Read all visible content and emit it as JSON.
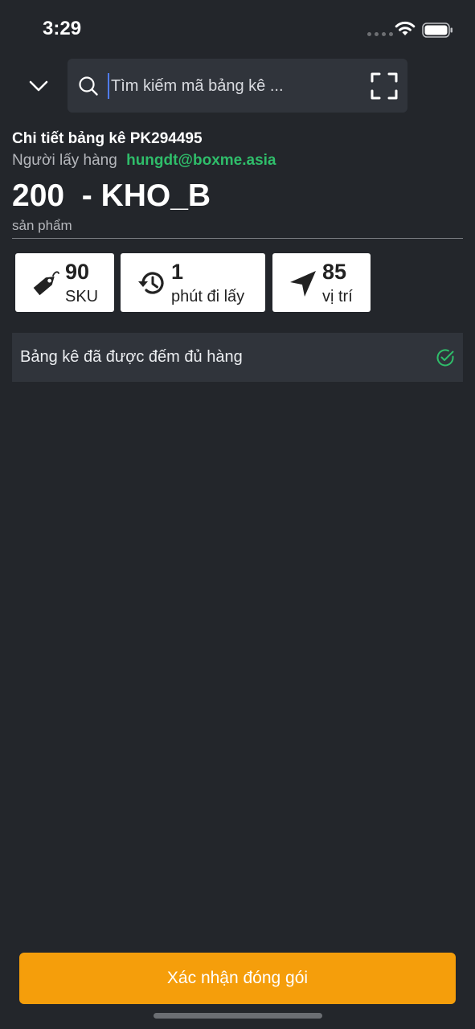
{
  "status_bar": {
    "time": "3:29"
  },
  "search": {
    "placeholder": "Tìm kiếm mã bảng kê ...",
    "value": ""
  },
  "detail": {
    "title": "Chi tiết bảng kê PK294495",
    "picker_label": "Người lấy hàng",
    "picker_email": "hungdt@boxme.asia",
    "product_count": "200",
    "warehouse": "  - KHO_B",
    "unit_label": "sản phẩm"
  },
  "stats": [
    {
      "icon": "tag-icon",
      "value": "90",
      "label": "SKU"
    },
    {
      "icon": "history-clock-icon",
      "value": "1",
      "label": "phút đi lấy"
    },
    {
      "icon": "navigation-arrow-icon",
      "value": "85",
      "label": "vị trí"
    }
  ],
  "notice": {
    "text": "Bảng kê đã được đếm đủ hàng",
    "icon": "check-circle-icon",
    "icon_color": "#2fbd6a"
  },
  "actions": {
    "confirm_label": "Xác nhận đóng gói"
  },
  "colors": {
    "background": "#23262b",
    "panel": "#30343b",
    "accent": "#f59e0b",
    "success": "#2fbd6a"
  }
}
